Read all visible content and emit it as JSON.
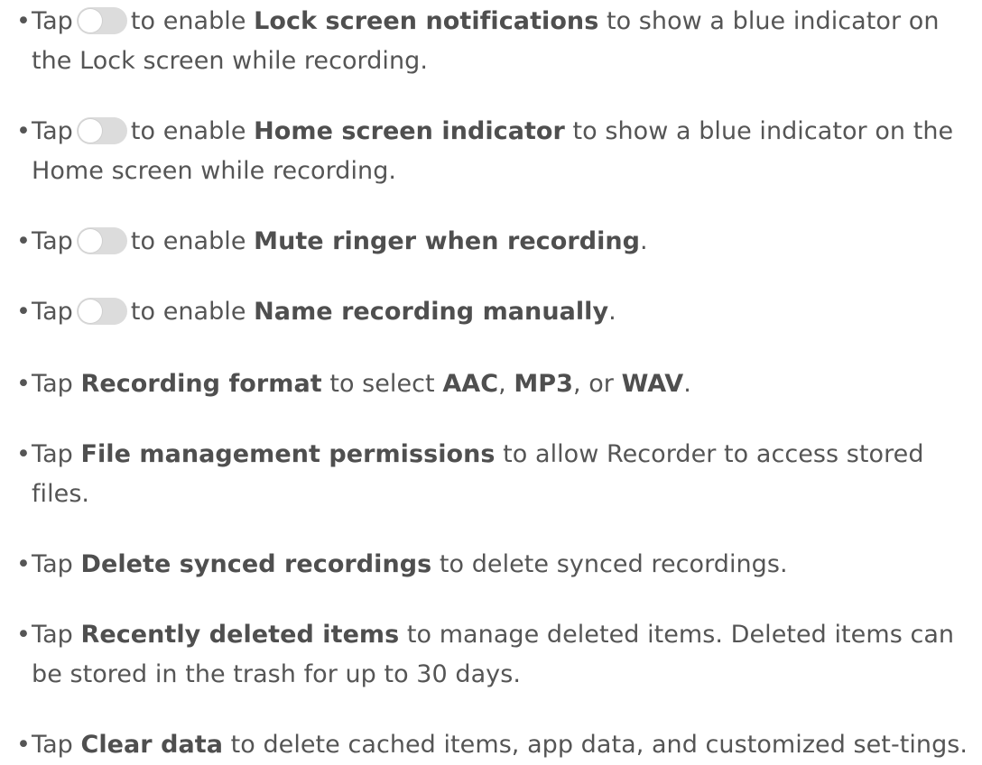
{
  "items": [
    {
      "id": "lock_screen",
      "parts": [
        [
          "t",
          "Tap"
        ],
        [
          "toggle"
        ],
        [
          "t",
          "to enable "
        ],
        [
          "b",
          "Lock screen notifications"
        ],
        [
          "t",
          " to show a blue indicator on the Lock screen while recording."
        ]
      ]
    },
    {
      "id": "home_screen",
      "parts": [
        [
          "t",
          "Tap"
        ],
        [
          "toggle"
        ],
        [
          "t",
          "to enable "
        ],
        [
          "b",
          "Home screen indicator"
        ],
        [
          "t",
          " to show a blue indicator on the Home screen while recording."
        ]
      ]
    },
    {
      "id": "mute_ringer",
      "parts": [
        [
          "t",
          "Tap"
        ],
        [
          "toggle"
        ],
        [
          "t",
          "to enable "
        ],
        [
          "b",
          "Mute ringer when recording"
        ],
        [
          "t",
          "."
        ]
      ]
    },
    {
      "id": "name_recording",
      "parts": [
        [
          "t",
          "Tap"
        ],
        [
          "toggle"
        ],
        [
          "t",
          "to enable "
        ],
        [
          "b",
          "Name recording manually"
        ],
        [
          "t",
          "."
        ]
      ]
    },
    {
      "id": "recording_format",
      "parts": [
        [
          "t",
          "Tap "
        ],
        [
          "b",
          "Recording format"
        ],
        [
          "t",
          " to select "
        ],
        [
          "b",
          "AAC"
        ],
        [
          "t",
          ", "
        ],
        [
          "b",
          "MP3"
        ],
        [
          "t",
          ", or "
        ],
        [
          "b",
          "WAV"
        ],
        [
          "t",
          "."
        ]
      ]
    },
    {
      "id": "file_permissions",
      "parts": [
        [
          "t",
          "Tap "
        ],
        [
          "b",
          "File management permissions"
        ],
        [
          "t",
          " to allow Recorder to access stored files."
        ]
      ]
    },
    {
      "id": "delete_synced",
      "parts": [
        [
          "t",
          "Tap "
        ],
        [
          "b",
          "Delete synced recordings"
        ],
        [
          "t",
          " to delete synced recordings."
        ]
      ]
    },
    {
      "id": "recently_deleted",
      "parts": [
        [
          "t",
          "Tap "
        ],
        [
          "b",
          "Recently deleted items"
        ],
        [
          "t",
          " to manage deleted items. Deleted items can be stored in the trash for up to 30 days."
        ]
      ]
    },
    {
      "id": "clear_data",
      "parts": [
        [
          "t",
          "Tap "
        ],
        [
          "b",
          "Clear data"
        ],
        [
          "t",
          " to delete cached items, app data, and customized set-tings."
        ]
      ]
    }
  ],
  "bullet": "•",
  "toggle_state": "off",
  "colors": {
    "text": "#555555",
    "bold": "#4f4f4f",
    "toggle_track": "#dcdcdc",
    "toggle_knob": "#ffffff"
  }
}
